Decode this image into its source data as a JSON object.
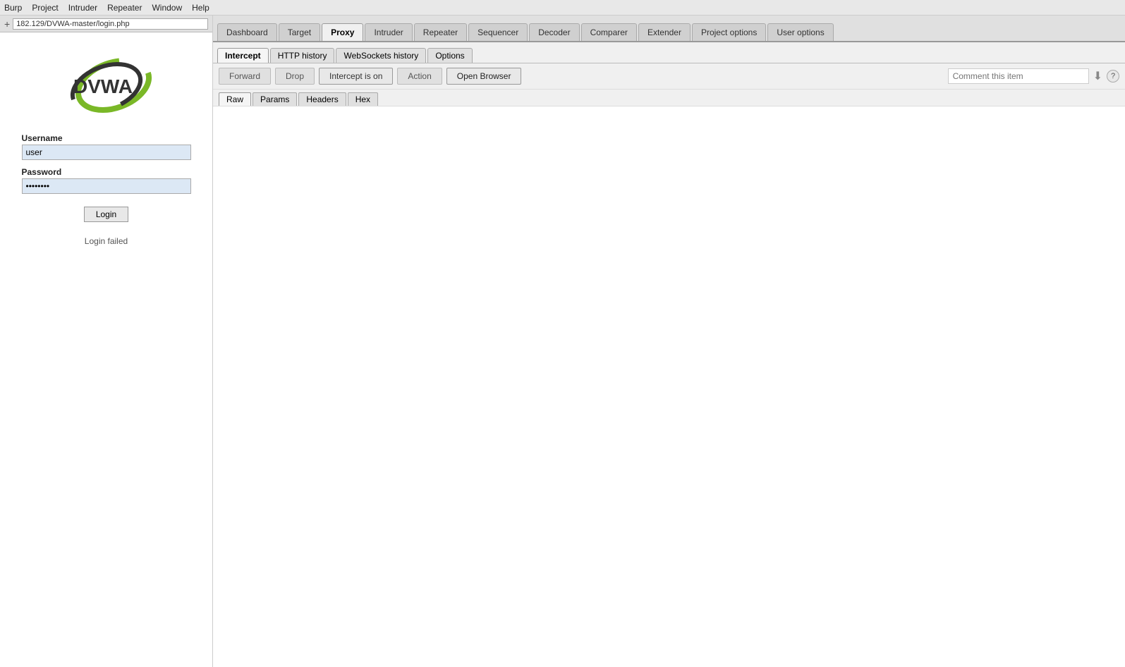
{
  "menu": {
    "items": [
      "Burp",
      "Project",
      "Intruder",
      "Repeater",
      "Window",
      "Help"
    ]
  },
  "left_panel": {
    "address_bar": "182.129/DVWA-master/login.php",
    "plus_label": "+",
    "username_label": "Username",
    "username_value": "user",
    "password_label": "Password",
    "password_value": "••••••••",
    "login_button": "Login",
    "login_failed": "Login failed"
  },
  "top_tabs": {
    "tabs": [
      "Dashboard",
      "Target",
      "Proxy",
      "Intruder",
      "Repeater",
      "Sequencer",
      "Decoder",
      "Comparer",
      "Extender",
      "Project options",
      "User options"
    ],
    "active": "Proxy"
  },
  "secondary_tabs": {
    "tabs": [
      "Intercept",
      "HTTP history",
      "WebSockets history",
      "Options"
    ],
    "active": "Intercept"
  },
  "toolbar": {
    "forward_label": "Forward",
    "drop_label": "Drop",
    "intercept_on_label": "Intercept is on",
    "action_label": "Action",
    "open_browser_label": "Open Browser",
    "comment_placeholder": "Comment this item",
    "arrow_icon": "⬇",
    "help_icon": "?"
  },
  "content_tabs": {
    "tabs": [
      "Raw",
      "Params",
      "Headers",
      "Hex"
    ],
    "active": "Raw"
  }
}
